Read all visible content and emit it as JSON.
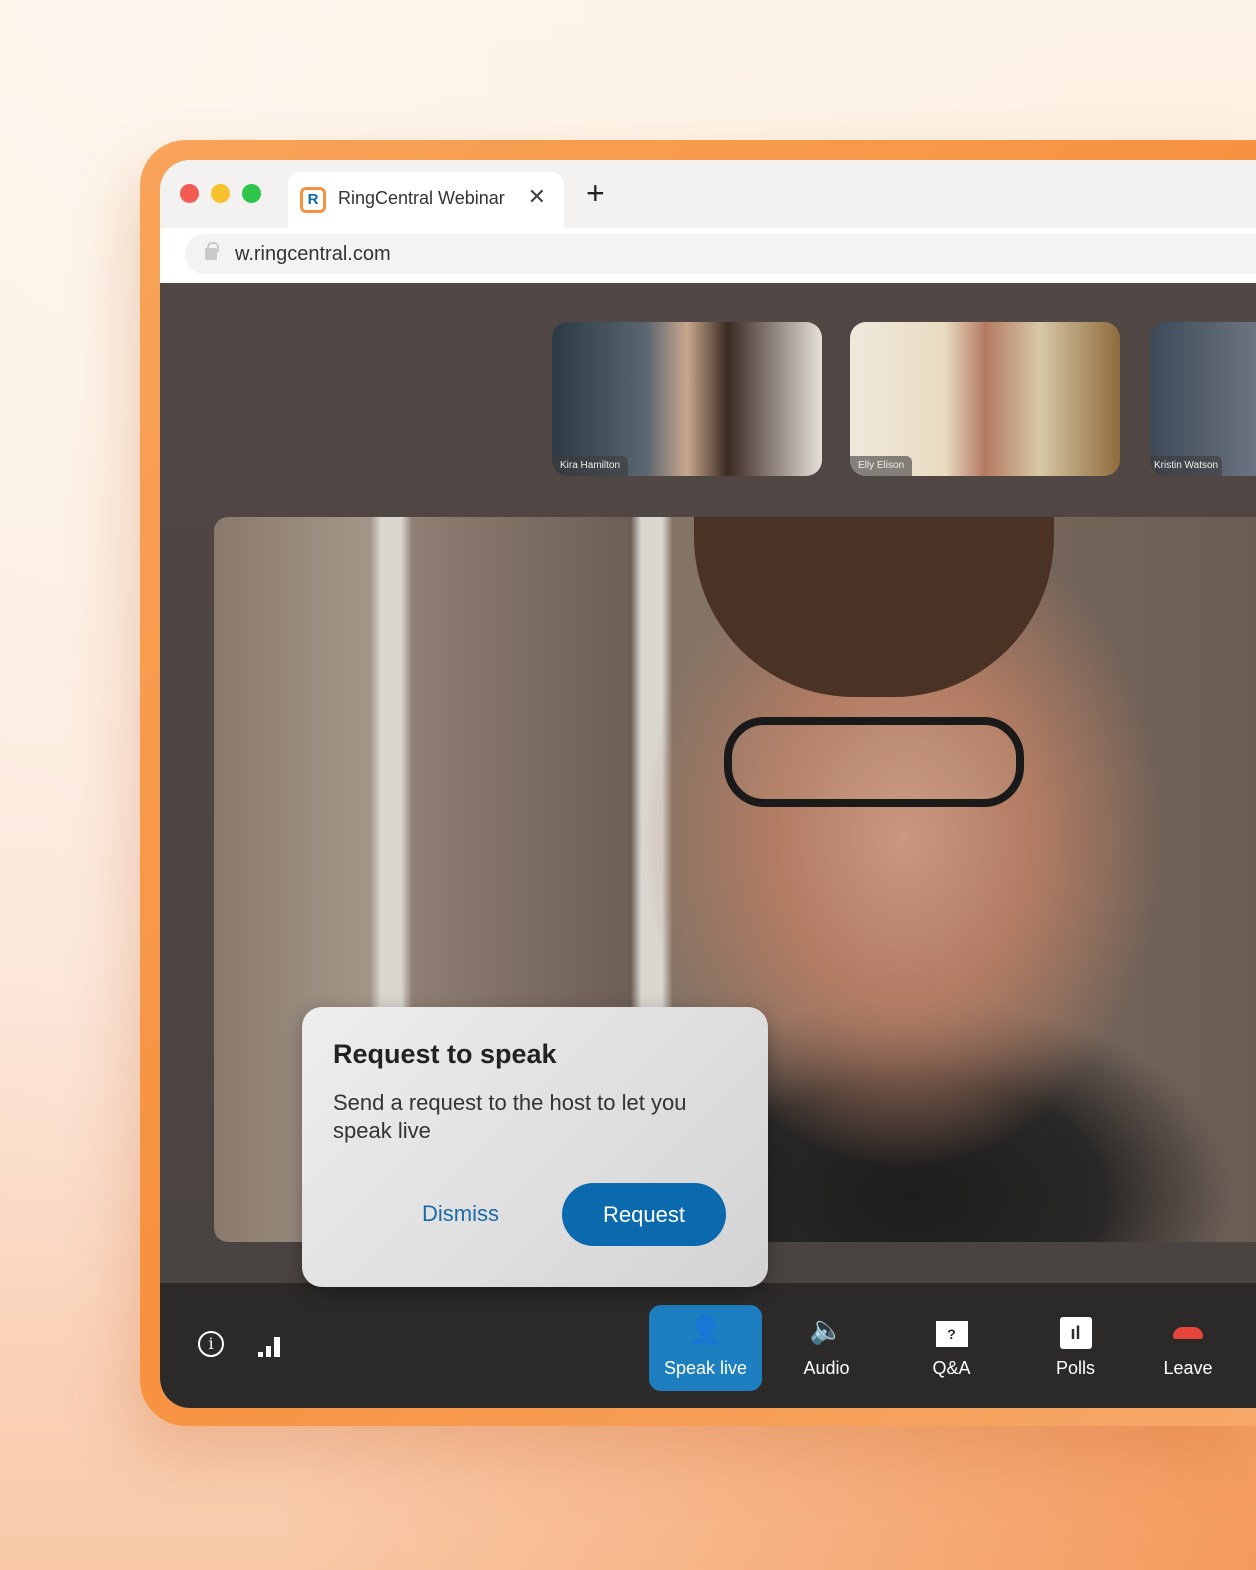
{
  "browser": {
    "tab_title": "RingCentral Webinar",
    "url": "w.ringcentral.com",
    "favicon_letter": "R"
  },
  "participants": [
    {
      "name": "Kira Hamilton"
    },
    {
      "name": "Elly Elison"
    },
    {
      "name": "Kristin Watson"
    }
  ],
  "dialog": {
    "title": "Request to speak",
    "body": "Send a request to the host to let you speak live",
    "dismiss_label": "Dismiss",
    "request_label": "Request"
  },
  "toolbar": {
    "items": [
      {
        "label": "Speak live",
        "icon": "speak-live-icon",
        "active": true
      },
      {
        "label": "Audio",
        "icon": "speaker-icon"
      },
      {
        "label": "Q&A",
        "icon": "qa-icon"
      },
      {
        "label": "Polls",
        "icon": "polls-icon"
      },
      {
        "label": "Leave",
        "icon": "hang-up-icon"
      }
    ]
  },
  "colors": {
    "accent": "#1e7fc0",
    "frame": "#f7913f",
    "leave": "#e8453c"
  }
}
